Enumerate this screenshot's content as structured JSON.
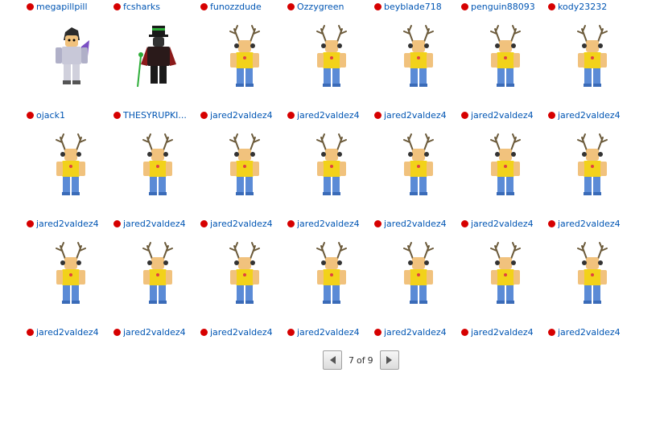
{
  "rows": [
    [
      "megapillpill",
      "fcsharks",
      "funozzdude",
      "Ozzygreen",
      "beyblade718",
      "penguin88093",
      "kody23232"
    ],
    [
      "ojack1",
      "THESYRUPKI...",
      "jared2valdez4",
      "jared2valdez4",
      "jared2valdez4",
      "jared2valdez4",
      "jared2valdez4"
    ],
    [
      "jared2valdez4",
      "jared2valdez4",
      "jared2valdez4",
      "jared2valdez4",
      "jared2valdez4",
      "jared2valdez4",
      "jared2valdez4"
    ],
    [
      "jared2valdez4",
      "jared2valdez4",
      "jared2valdez4",
      "jared2valdez4",
      "jared2valdez4",
      "jared2valdez4",
      "jared2valdez4"
    ]
  ],
  "avatars": [
    [
      "avatar-purple-armor",
      "avatar-top-hat",
      "avatar-antlers",
      "avatar-antlers",
      "avatar-antlers",
      "avatar-antlers",
      "avatar-antlers"
    ],
    [
      "avatar-antlers",
      "avatar-antlers",
      "avatar-antlers",
      "avatar-antlers",
      "avatar-antlers",
      "avatar-antlers",
      "avatar-antlers"
    ],
    [
      "avatar-antlers",
      "avatar-antlers",
      "avatar-antlers",
      "avatar-antlers",
      "avatar-antlers",
      "avatar-antlers",
      "avatar-antlers"
    ]
  ],
  "colors": {
    "link": "#0055b3",
    "online_dot": "#d60000",
    "shirt": "#f2d21a",
    "pants": "#5b8bd6"
  },
  "pager": {
    "current": "7",
    "of": "of",
    "total": "9"
  }
}
